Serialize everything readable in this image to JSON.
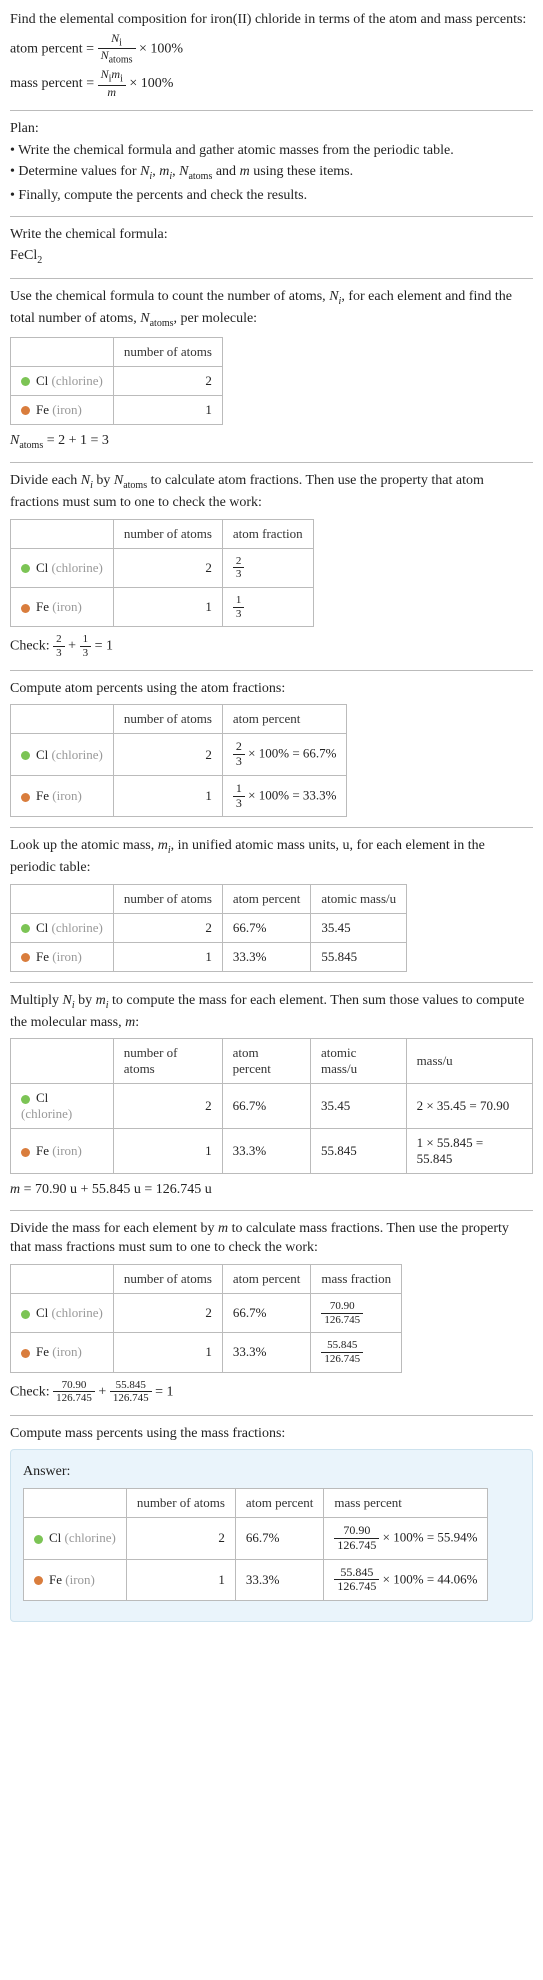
{
  "intro": {
    "line1": "Find the elemental composition for iron(II) chloride in terms of the atom and mass percents:",
    "atom_percent_label": "atom percent =",
    "ap_num": "N",
    "ap_num_sub": "i",
    "ap_den": "N",
    "ap_den_sub": "atoms",
    "ap_tail": "× 100%",
    "mass_percent_label": "mass percent =",
    "mp_num_left": "N",
    "mp_num_left_sub": "i",
    "mp_num_right": "m",
    "mp_num_right_sub": "i",
    "mp_den": "m",
    "mp_tail": "× 100%"
  },
  "plan": {
    "heading": "Plan:",
    "b1": "• Write the chemical formula and gather atomic masses from the periodic table.",
    "b2_a": "• Determine values for ",
    "b2_b": " using these items.",
    "b3": "• Finally, compute the percents and check the results."
  },
  "formula": {
    "heading": "Write the chemical formula:",
    "value_a": "FeCl",
    "value_sub": "2"
  },
  "count": {
    "para_a": "Use the chemical formula to count the number of atoms, ",
    "para_b": ", for each element and find the total number of atoms, ",
    "para_c": ", per molecule:",
    "h_natoms": "number of atoms",
    "cl_label_a": "Cl",
    "cl_label_b": " (chlorine)",
    "cl_n": "2",
    "fe_label_a": "Fe",
    "fe_label_b": " (iron)",
    "fe_n": "1",
    "sum": " = 2 + 1 = 3"
  },
  "atomfrac": {
    "para_a": "Divide each ",
    "para_b": " by ",
    "para_c": " to calculate atom fractions. Then use the property that atom fractions must sum to one to check the work:",
    "h_natoms": "number of atoms",
    "h_frac": "atom fraction",
    "cl_n": "2",
    "cl_num": "2",
    "cl_den": "3",
    "fe_n": "1",
    "fe_num": "1",
    "fe_den": "3",
    "check_a": "Check: ",
    "check_b": " = 1"
  },
  "atompct": {
    "heading": "Compute atom percents using the atom fractions:",
    "h_natoms": "number of atoms",
    "h_pct": "atom percent",
    "cl_n": "2",
    "cl_num": "2",
    "cl_den": "3",
    "cl_tail": " × 100% = 66.7%",
    "fe_n": "1",
    "fe_num": "1",
    "fe_den": "3",
    "fe_tail": " × 100% = 33.3%"
  },
  "mass": {
    "para_a": "Look up the atomic mass, ",
    "para_b": ", in unified atomic mass units, u, for each element in the periodic table:",
    "h_natoms": "number of atoms",
    "h_pct": "atom percent",
    "h_mass": "atomic mass/u",
    "cl_n": "2",
    "cl_pct": "66.7%",
    "cl_mass": "35.45",
    "fe_n": "1",
    "fe_pct": "33.3%",
    "fe_mass": "55.845"
  },
  "molec": {
    "para_a": "Multiply ",
    "para_b": " by ",
    "para_c": " to compute the mass for each element. Then sum those values to compute the molecular mass, ",
    "para_d": ":",
    "h_natoms": "number of atoms",
    "h_pct": "atom percent",
    "h_mass": "atomic mass/u",
    "h_massu": "mass/u",
    "cl_n": "2",
    "cl_pct": "66.7%",
    "cl_amass": "35.45",
    "cl_calc": "2 × 35.45 = 70.90",
    "fe_n": "1",
    "fe_pct": "33.3%",
    "fe_amass": "55.845",
    "fe_calc": "1 × 55.845 = 55.845",
    "sum_a": "m",
    "sum_b": " = 70.90 u + 55.845 u = 126.745 u"
  },
  "massfrac": {
    "para_a": "Divide the mass for each element by ",
    "para_b": " to calculate mass fractions. Then use the property that mass fractions must sum to one to check the work:",
    "h_natoms": "number of atoms",
    "h_pct": "atom percent",
    "h_frac": "mass fraction",
    "cl_n": "2",
    "cl_pct": "66.7%",
    "cl_num": "70.90",
    "cl_den": "126.745",
    "fe_n": "1",
    "fe_pct": "33.3%",
    "fe_num": "55.845",
    "fe_den": "126.745",
    "check_a": "Check: ",
    "check_b": " = 1"
  },
  "answer": {
    "heading": "Compute mass percents using the mass fractions:",
    "label": "Answer:",
    "h_natoms": "number of atoms",
    "h_pct": "atom percent",
    "h_mpct": "mass percent",
    "cl_n": "2",
    "cl_pct": "66.7%",
    "cl_num": "70.90",
    "cl_den": "126.745",
    "cl_tail": " × 100% = 55.94%",
    "fe_n": "1",
    "fe_pct": "33.3%",
    "fe_num": "55.845",
    "fe_den": "126.745",
    "fe_tail": " × 100% = 44.06%"
  },
  "labels": {
    "cl_a": "Cl",
    "cl_b": " (chlorine)",
    "fe_a": "Fe",
    "fe_b": " (iron)",
    "Ni": "N",
    "Ni_sub": "i",
    "mi": "m",
    "mi_sub": "i",
    "Natoms": "N",
    "Natoms_sub": "atoms",
    "m": "m"
  }
}
